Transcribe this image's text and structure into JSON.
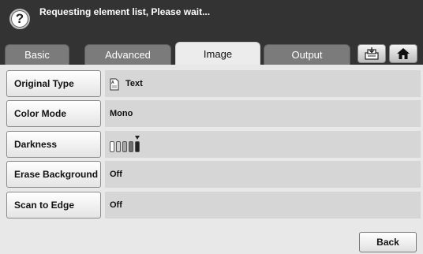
{
  "status": {
    "help_icon": "?",
    "message": "Requesting element list, Please wait..."
  },
  "tabs": [
    {
      "label": "Basic",
      "active": false
    },
    {
      "label": "Advanced",
      "active": false
    },
    {
      "label": "Image",
      "active": true
    },
    {
      "label": "Output",
      "active": false
    }
  ],
  "toolbar_icons": [
    "job-status-icon",
    "home-icon"
  ],
  "settings": {
    "original_type": {
      "label": "Original Type",
      "value": "Text",
      "icon": "text-document-icon"
    },
    "color_mode": {
      "label": "Color Mode",
      "value": "Mono"
    },
    "darkness": {
      "label": "Darkness",
      "levels": 5,
      "selected_level": 5,
      "icon": "darkness-scale-icon"
    },
    "erase_background": {
      "label": "Erase Background",
      "value": "Off"
    },
    "scan_to_edge": {
      "label": "Scan to Edge",
      "value": "Off"
    }
  },
  "footer": {
    "back_label": "Back"
  },
  "colors": {
    "status_bar": "#333333",
    "tab_inactive": "#7b7b7b",
    "tab_active": "#ececec",
    "panel_bg": "#e8e8e8",
    "value_bg": "#d6d6d6"
  }
}
